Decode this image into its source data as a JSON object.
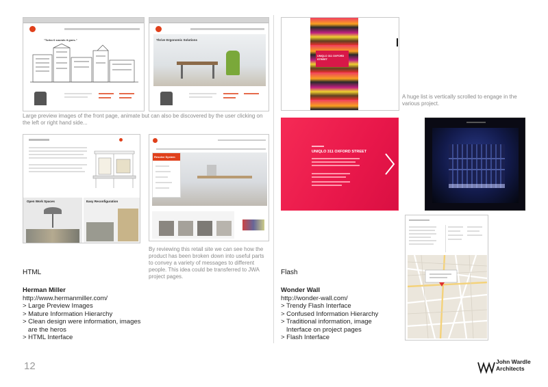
{
  "captions": {
    "hm_preview": "Large preview images of the front page, animate but can also be discovered by the user clicking on the left or right hand side...",
    "hm_retail": "By reviewing this retail site we can see how the product has been broken down into useful parts to convey a variety of messages to different people. This idea could be transferred to JWA project pages.",
    "ww_scroll": "A huge list is vertically scrolled to engage in the various project."
  },
  "left": {
    "heading": "HTML",
    "title": "Herman Miller",
    "url": "http://www.hermanmiller.com/",
    "bullets": [
      "> Large Preview Images",
      "> Mature Information Hierarchy",
      "> Clean design were information, images",
      "   are the heros",
      "> HTML Interface"
    ]
  },
  "right": {
    "heading": "Flash",
    "title": "Wonder Wall",
    "url": "http://wonder-wall.com/",
    "bullets": [
      "> Trendy Flash Interface",
      "> Confused Information Hierarchy",
      "> Traditional information, image",
      "   Interface on project pages",
      "> Flash Interface"
    ]
  },
  "screens": {
    "hm1_hero": "\"Turbo 6 sounds it goes.\"",
    "hm2_hero": "Thrive Ergonomic Solutions",
    "hm3_tile1": "Open Work Spaces",
    "hm3_tile2": "Easy Reconfiguration",
    "hm4_panel": "Resolve System",
    "ww_pink_title": "UNIQLO 311 OXFORD STREET"
  },
  "footer": {
    "page_number": "12",
    "logo_line1": "John Wardle",
    "logo_line2": "Architects"
  },
  "colors": {
    "hm_red": "#e0401b",
    "ww_pink": "#f0234e",
    "caption_grey": "#8a8a8a"
  }
}
